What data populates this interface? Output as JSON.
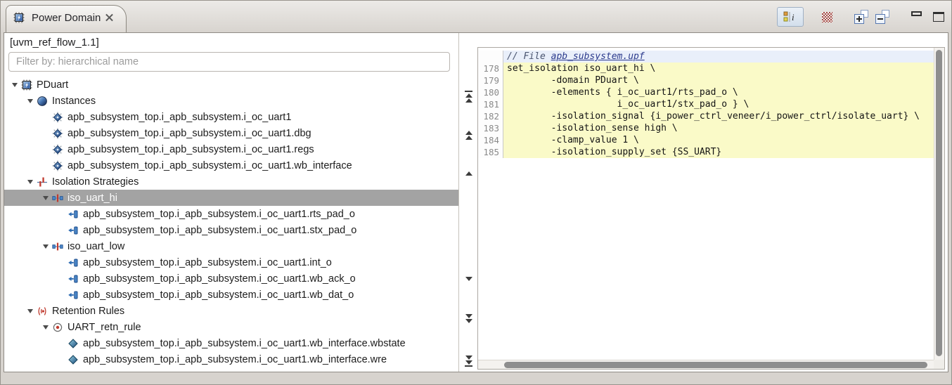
{
  "tab": {
    "title": "Power Domain"
  },
  "toolbar": {
    "buttons": [
      "show-properties",
      "highlight-disabled",
      "expand-all",
      "collapse-all",
      "minimize-view",
      "maximize-view"
    ]
  },
  "panel": {
    "scope_label": "[uvm_ref_flow_1.1]",
    "filter_placeholder": "Filter by: hierarchical name"
  },
  "tree": {
    "rows": [
      {
        "level": 0,
        "icon": "power-domain",
        "label": "PDuart",
        "expanded": true
      },
      {
        "level": 1,
        "icon": "instances-folder",
        "label": "Instances",
        "expanded": true
      },
      {
        "level": 2,
        "icon": "module-instance",
        "label": "apb_subsystem_top.i_apb_subsystem.i_oc_uart1"
      },
      {
        "level": 2,
        "icon": "module-instance",
        "label": "apb_subsystem_top.i_apb_subsystem.i_oc_uart1.dbg"
      },
      {
        "level": 2,
        "icon": "module-instance",
        "label": "apb_subsystem_top.i_apb_subsystem.i_oc_uart1.regs"
      },
      {
        "level": 2,
        "icon": "module-instance",
        "label": "apb_subsystem_top.i_apb_subsystem.i_oc_uart1.wb_interface"
      },
      {
        "level": 1,
        "icon": "isolation-strategies",
        "label": "Isolation Strategies",
        "expanded": true
      },
      {
        "level": 2,
        "icon": "isolation-strategy",
        "label": "iso_uart_hi",
        "expanded": true,
        "selected": true
      },
      {
        "level": 3,
        "icon": "port",
        "label": "apb_subsystem_top.i_apb_subsystem.i_oc_uart1.rts_pad_o"
      },
      {
        "level": 3,
        "icon": "port",
        "label": "apb_subsystem_top.i_apb_subsystem.i_oc_uart1.stx_pad_o"
      },
      {
        "level": 2,
        "icon": "isolation-strategy",
        "label": "iso_uart_low",
        "expanded": true
      },
      {
        "level": 3,
        "icon": "port",
        "label": "apb_subsystem_top.i_apb_subsystem.i_oc_uart1.int_o"
      },
      {
        "level": 3,
        "icon": "port",
        "label": "apb_subsystem_top.i_apb_subsystem.i_oc_uart1.wb_ack_o"
      },
      {
        "level": 3,
        "icon": "port",
        "label": "apb_subsystem_top.i_apb_subsystem.i_oc_uart1.wb_dat_o"
      },
      {
        "level": 1,
        "icon": "retention-rules",
        "label": "Retention Rules",
        "expanded": true
      },
      {
        "level": 2,
        "icon": "retention-rule",
        "label": "UART_retn_rule",
        "expanded": true
      },
      {
        "level": 3,
        "icon": "register",
        "label": "apb_subsystem_top.i_apb_subsystem.i_oc_uart1.wb_interface.wbstate"
      },
      {
        "level": 3,
        "icon": "register",
        "label": "apb_subsystem_top.i_apb_subsystem.i_oc_uart1.wb_interface.wre"
      }
    ]
  },
  "nav": {
    "buttons": [
      "go-to-first",
      "previous-group",
      "previous",
      "next",
      "next-group",
      "go-to-last"
    ]
  },
  "editor": {
    "file_header": {
      "comment_prefix": "// File ",
      "file_name": "apb_subsystem.upf"
    },
    "lines": [
      {
        "number": "178",
        "text": "set_isolation iso_uart_hi \\",
        "highlighted": true
      },
      {
        "number": "179",
        "text": "        -domain PDuart \\",
        "highlighted": true
      },
      {
        "number": "180",
        "text": "        -elements { i_oc_uart1/rts_pad_o \\",
        "highlighted": true
      },
      {
        "number": "181",
        "text": "                    i_oc_uart1/stx_pad_o } \\",
        "highlighted": true
      },
      {
        "number": "182",
        "text": "        -isolation_signal {i_power_ctrl_veneer/i_power_ctrl/isolate_uart} \\",
        "highlighted": true
      },
      {
        "number": "183",
        "text": "        -isolation_sense high \\",
        "highlighted": true
      },
      {
        "number": "184",
        "text": "        -clamp_value 1 \\",
        "highlighted": true
      },
      {
        "number": "185",
        "text": "        -isolation_supply_set {SS_UART}",
        "highlighted": true
      }
    ]
  },
  "colors": {
    "highlight_yellow": "#fafac8",
    "header_blue": "#e9effa",
    "link_blue": "#2b3a8c",
    "selection_gray": "#a3a3a3",
    "accent_red": "#c03a2e",
    "accent_blue": "#4a86c8"
  }
}
